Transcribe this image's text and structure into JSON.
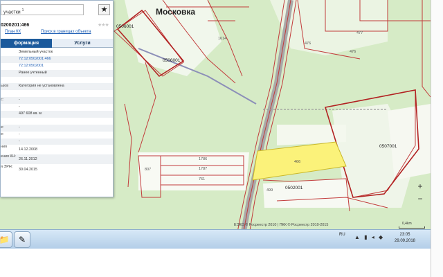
{
  "map": {
    "place_name": "Московка",
    "block_labels": [
      "0506001",
      "0506001",
      "0507001",
      "0502001"
    ],
    "parcel_labels": [
      "1614",
      "476",
      "477",
      "476",
      "1786",
      "1787",
      "761",
      "807",
      "466",
      "499"
    ],
    "copyright": "ЕЭКО © Росреестр 2010 | ПКК © Росреестр 2010-2015",
    "scale_label": "0,4km",
    "zoom_in_label": "+",
    "zoom_out_label": "−",
    "colors": {
      "background": "#d6ebc6",
      "parcel_border": "#c23b3b",
      "selected_parcel": "#fbf27a",
      "road": "#9b9b9b"
    }
  },
  "panel": {
    "search_text": "участки",
    "search_superscript": "1",
    "star_icon": "star-icon",
    "cadastral_number": "0200201:466",
    "rating_stars": "★★★",
    "links": [
      "План КК",
      "Поиск в границах объекта"
    ],
    "links_prefix": "",
    "tabs": [
      "формация",
      "Услуги"
    ],
    "rows": [
      {
        "label": "",
        "value": "Земельный участок",
        "type": "normal"
      },
      {
        "label": "",
        "value": "72:12:0502001:466",
        "type": "link"
      },
      {
        "label": "",
        "value": "72:12:0502001",
        "type": "link"
      },
      {
        "label": "",
        "value": "Ранее учтенный",
        "type": "normal"
      },
      {
        "label": "",
        "value": "",
        "type": "normal"
      },
      {
        "label": "ьзов",
        "value": "Категория не установлена",
        "type": "normal"
      },
      {
        "label": "",
        "value": "",
        "type": "normal"
      },
      {
        "label": "с:",
        "value": "-",
        "type": "normal"
      },
      {
        "label": "",
        "value": "-",
        "type": "normal"
      },
      {
        "label": "",
        "value": "497 608 кв. м",
        "type": "normal"
      },
      {
        "label": "",
        "value": "",
        "type": "normal"
      },
      {
        "label": "е:",
        "value": "-",
        "type": "normal"
      },
      {
        "label": "е:",
        "value": "-",
        "type": "normal"
      },
      {
        "label": "",
        "value": "-",
        "type": "normal"
      },
      {
        "label": "ния",
        "value": "14.12.2008",
        "type": "normal"
      },
      {
        "label": "ения КН:",
        "value": "26.11.2012",
        "type": "normal"
      },
      {
        "label": "я ЭРН:",
        "value": "30.04.2015",
        "type": "normal"
      }
    ]
  },
  "taskbar": {
    "language": "RU",
    "time": "23:05",
    "date": "29.09.2018",
    "tray_icons": "▲ ▮ ◂ ◆"
  }
}
